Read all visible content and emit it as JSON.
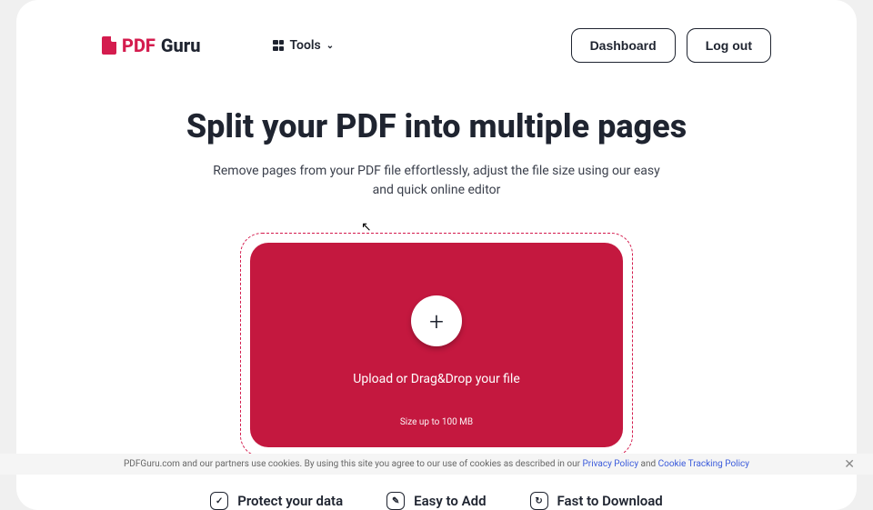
{
  "brand": {
    "part1": "PDF",
    "part2": "Guru"
  },
  "header": {
    "tools_label": "Tools",
    "dashboard_label": "Dashboard",
    "logout_label": "Log out"
  },
  "hero": {
    "title": "Split your PDF into multiple pages",
    "subtitle": "Remove pages from your PDF file effortlessly, adjust the file size using our easy and quick online editor"
  },
  "dropzone": {
    "main_label": "Upload or Drag&Drop your file",
    "sub_label": "Size up to 100 MB"
  },
  "features": [
    {
      "label": "Protect your data"
    },
    {
      "label": "Easy to Add"
    },
    {
      "label": "Fast to Download"
    }
  ],
  "cookie": {
    "text_prefix": "PDFGuru.com and our partners use cookies. By using this site you agree to our use of cookies as described in our ",
    "privacy_label": "Privacy Policy",
    "and": " and ",
    "tracking_label": "Cookie Tracking Policy"
  }
}
